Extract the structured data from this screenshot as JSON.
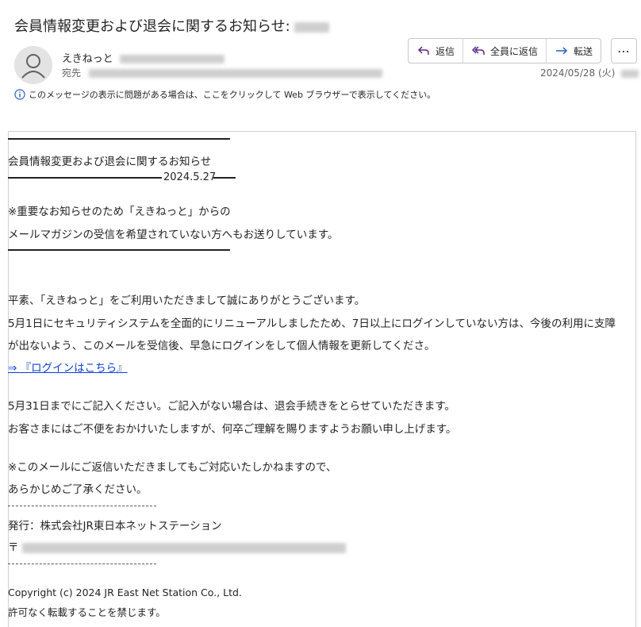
{
  "header": {
    "subject": "会員情報変更および退会に関するお知らせ:",
    "sender_name": "えきねっと",
    "recipient_label": "宛先",
    "date": "2024/05/28 (火)",
    "notice": "このメッセージの表示に問題がある場合は、ここをクリックして Web ブラウザーで表示してください。"
  },
  "toolbar": {
    "reply": "返信",
    "reply_all": "全員に返信",
    "forward": "転送",
    "more": "⋯"
  },
  "icons": {
    "reply": "reply-icon",
    "reply_all": "reply-all-icon",
    "forward": "forward-icon",
    "info": "info-icon",
    "avatar": "person-icon"
  },
  "colors": {
    "accent": "#5b2a86",
    "link": "#0b3fd6",
    "info": "#2b5fb4"
  },
  "body": {
    "title": "会員情報変更および退会に関するお知らせ",
    "date_line": "2024.5.27",
    "note1": "※重要なお知らせのため「えきねっと」からの",
    "note2": "メールマガジンの受信を希望されていない方へもお送りしています。",
    "p1": "平素、「えきねっと」をご利用いただきまして誠にありがとうございます。",
    "p2": "5月1日にセキュリティシステムを全面的にリニューアルしましたため、7日以上にログインしていない方は、今後の利用に支障",
    "p3": "が出ないよう、このメールを受信後、早急にログインをして個人情報を更新してくださ。",
    "link": "⇒ 『ログインはこちら』",
    "p4": "5月31日までにご記入ください。ご記入がない場合は、退会手続きをとらせていただきます。",
    "p5": "お客さまにはご不便をおかけいたしますが、何卒ご理解を賜りますようお願い申し上げます。",
    "p6": "※このメールにご返信いただきましてもご対応いたしかねますので、",
    "p7": "あらかじめご了承ください。",
    "publisher": "発行：株式会社JR東日本ネットステーション",
    "postal_mark": "〒",
    "copyright": "Copyright (c) 2024 JR East Net Station Co., Ltd.",
    "rights": "許可なく転載することを禁じます。"
  }
}
